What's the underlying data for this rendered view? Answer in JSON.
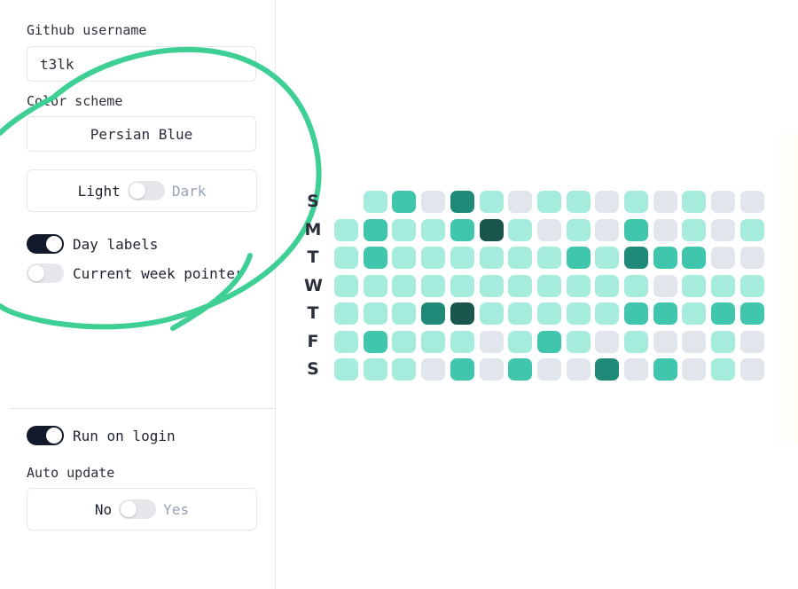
{
  "settings": {
    "github_username_label": "Github username",
    "github_username_value": "t3lk",
    "color_scheme_label": "Color scheme",
    "color_scheme_value": "Persian Blue",
    "theme": {
      "left": "Light",
      "right": "Dark",
      "value": "Light"
    },
    "day_labels": {
      "label": "Day labels",
      "enabled": true
    },
    "current_week_pointer": {
      "label": "Current week pointer",
      "enabled": false
    },
    "run_on_login": {
      "label": "Run on login",
      "enabled": true
    },
    "auto_update": {
      "label": "Auto update",
      "left": "No",
      "right": "Yes",
      "value": "No"
    }
  },
  "colors": {
    "accent_circle": "#3ecf95",
    "levels": [
      "#e1e5ec",
      "#a6ecdc",
      "#41c6ae",
      "#1f8a77",
      "#1a564b"
    ]
  },
  "heatmap": {
    "day_labels": [
      "S",
      "M",
      "T",
      "W",
      "T",
      "F",
      "S"
    ],
    "weeks": 16,
    "rows": [
      [
        -1,
        1,
        2,
        0,
        3,
        1,
        0,
        1,
        1,
        0,
        1,
        0,
        1,
        0,
        0
      ],
      [
        1,
        2,
        1,
        1,
        2,
        4,
        1,
        0,
        1,
        0,
        2,
        0,
        1,
        0,
        1
      ],
      [
        1,
        2,
        1,
        1,
        1,
        1,
        1,
        1,
        2,
        1,
        3,
        2,
        2,
        0,
        0
      ],
      [
        1,
        1,
        1,
        1,
        1,
        1,
        1,
        1,
        1,
        1,
        1,
        0,
        1,
        1,
        1
      ],
      [
        1,
        1,
        1,
        3,
        4,
        1,
        1,
        1,
        1,
        1,
        2,
        2,
        1,
        2,
        2
      ],
      [
        1,
        2,
        1,
        1,
        1,
        0,
        1,
        2,
        1,
        0,
        1,
        0,
        0,
        1,
        0
      ],
      [
        1,
        1,
        1,
        0,
        2,
        0,
        2,
        0,
        0,
        3,
        0,
        2,
        0,
        1,
        0
      ]
    ]
  }
}
